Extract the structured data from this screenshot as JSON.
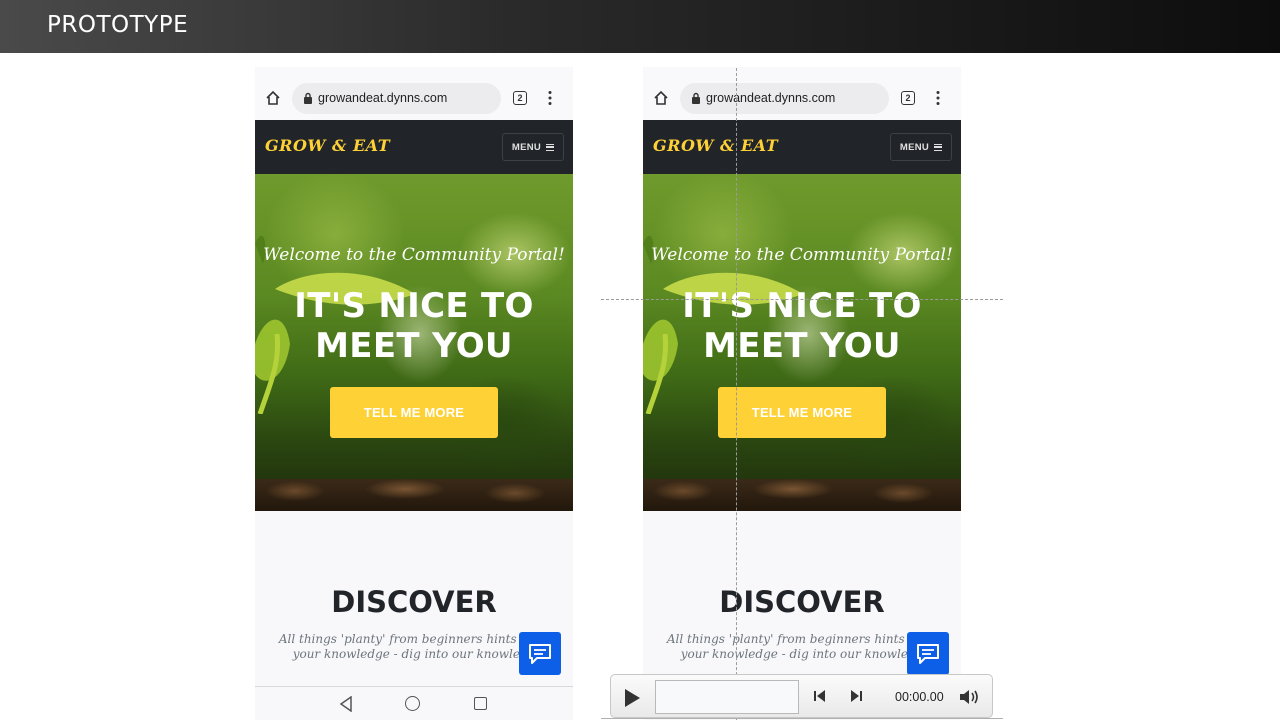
{
  "slide": {
    "title": "PROTOTYPE"
  },
  "phones": [
    {
      "url": "growandeat.dynns.com",
      "tab_count": "2",
      "brand": "GROW & EAT",
      "menu_label": "MENU",
      "welcome": "Welcome to the Community Portal!",
      "headline_line1": "IT'S NICE TO",
      "headline_line2": "MEET YOU",
      "cta": "TELL ME MORE",
      "section_title": "DISCOVER",
      "section_sub_line1": "All things 'planty' from beginners hints to re",
      "section_sub_line2": "your knowledge - dig into our knowledg"
    },
    {
      "url": "growandeat.dynns.com",
      "tab_count": "2",
      "brand": "GROW & EAT",
      "menu_label": "MENU",
      "welcome": "Welcome to the Community Portal!",
      "headline_line1": "IT'S NICE TO",
      "headline_line2": "MEET YOU",
      "cta": "TELL ME MORE",
      "section_title": "DISCOVER",
      "section_sub_line1": "All things 'planty' from beginners hints to re",
      "section_sub_line2": "your knowledge - dig into our knowledg"
    }
  ],
  "player": {
    "time": "00:00.00"
  },
  "colors": {
    "accent": "#fed136",
    "nav_dark": "#212529",
    "chat_blue": "#0d5fe8"
  },
  "icons": [
    "home-icon",
    "lock-icon",
    "tabs-icon",
    "kebab-menu-icon",
    "hamburger-icon",
    "chat-icon",
    "back-icon",
    "circle-home-icon",
    "recent-apps-icon",
    "play-icon",
    "prev-icon",
    "next-icon",
    "volume-icon"
  ]
}
